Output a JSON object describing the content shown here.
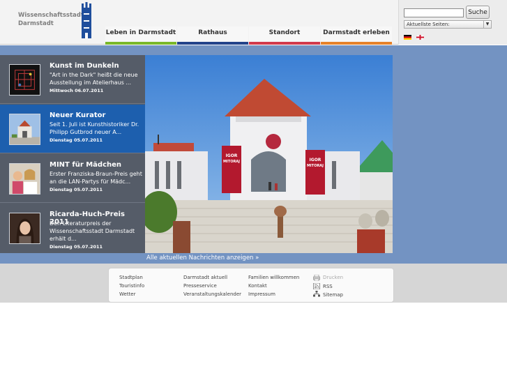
{
  "header": {
    "logo_line1": "Wissenschaftsstadt",
    "logo_line2": "Darmstadt",
    "nav": [
      {
        "label": "Leben in Darmstadt",
        "color": "#7ab829"
      },
      {
        "label": "Rathaus",
        "color": "#23448a"
      },
      {
        "label": "Standort",
        "color": "#d23a4b"
      },
      {
        "label": "Darmstadt erleben",
        "color": "#e5822a"
      }
    ],
    "search": {
      "value": "",
      "button_label": "Suche"
    },
    "select": {
      "selected": "Aktuellste Seiten:"
    }
  },
  "news": [
    {
      "title": "Kunst im Dunkeln",
      "text": "\"Art in the Dark\" heißt die neue Ausstellung im Atelierhaus ...",
      "date": "Mittwoch 06.07.2011"
    },
    {
      "title": "Neuer Kurator",
      "text": "Seit 1. Juli ist Kunsthistoriker Dr. Philipp Gutbrod neuer A...",
      "date": "Dienstag 05.07.2011"
    },
    {
      "title": "MINT für Mädchen",
      "text": "Erster Franziska-Braun-Preis geht an die LAN-Partys für Mädc...",
      "date": "Dienstag 05.07.2011"
    },
    {
      "title": "Ricarda-Huch-Preis 2011",
      "text": "Den Literaturpreis der Wissenschaftsstadt Darmstadt erhält d...",
      "date": "Dienstag 05.07.2011"
    }
  ],
  "hero": {
    "banner_left": "IGOR MITORAJ",
    "banner_right": "IGOR MITORAJ"
  },
  "all_news_link": "Alle aktuellen Nachrichten anzeigen »",
  "footer": {
    "col1": [
      "Stadtplan",
      "Touristinfo",
      "Wetter"
    ],
    "col2": [
      "Darmstadt aktuell",
      "Presseservice",
      "Veranstaltungskalender"
    ],
    "col3": [
      "Familien willkommen",
      "Kontakt",
      "Impressum"
    ],
    "col4": [
      "Drucken",
      "RSS",
      "Sitemap"
    ]
  }
}
